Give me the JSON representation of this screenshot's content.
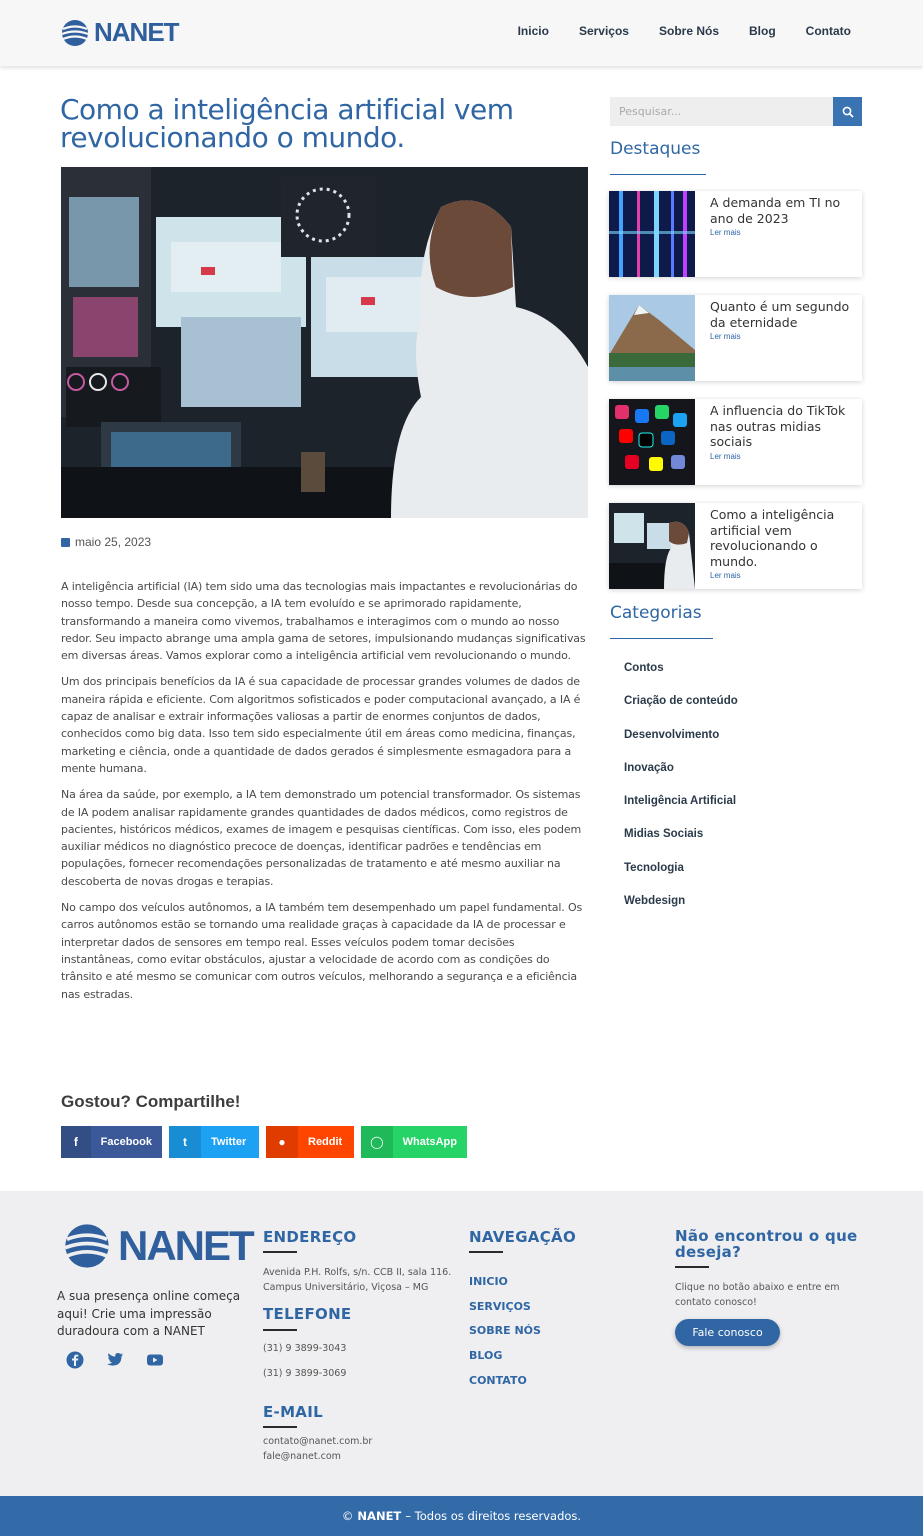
{
  "header": {
    "brand": "NANET",
    "nav": [
      "Inicio",
      "Serviços",
      "Sobre Nós",
      "Blog",
      "Contato"
    ]
  },
  "post": {
    "title": "Como a inteligência artificial vem revolucionando o mundo.",
    "date": "maio 25, 2023",
    "paragraphs": [
      "A inteligência artificial (IA) tem sido uma das tecnologias mais impactantes e revolucionárias do nosso tempo. Desde sua concepção, a IA tem evoluído e se aprimorado rapidamente, transformando a maneira como vivemos, trabalhamos e interagimos com o mundo ao nosso redor. Seu impacto abrange uma ampla gama de setores, impulsionando mudanças significativas em diversas áreas. Vamos explorar como a inteligência artificial vem revolucionando o mundo.",
      "Um dos principais benefícios da IA é sua capacidade de processar grandes volumes de dados de maneira rápida e eficiente. Com algoritmos sofisticados e poder computacional avançado, a IA é capaz de analisar e extrair informações valiosas a partir de enormes conjuntos de dados, conhecidos como big data. Isso tem sido especialmente útil em áreas como medicina, finanças, marketing e ciência, onde a quantidade de dados gerados é simplesmente esmagadora para a mente humana.",
      "Na área da saúde, por exemplo, a IA tem demonstrado um potencial transformador. Os sistemas de IA podem analisar rapidamente grandes quantidades de dados médicos, como registros de pacientes, históricos médicos, exames de imagem e pesquisas científicas. Com isso, eles podem auxiliar médicos no diagnóstico precoce de doenças, identificar padrões e tendências em populações, fornecer recomendações personalizadas de tratamento e até mesmo auxiliar na descoberta de novas drogas e terapias.",
      "No campo dos veículos autônomos, a IA também tem desempenhado um papel fundamental. Os carros autônomos estão se tornando uma realidade graças à capacidade da IA de processar e interpretar dados de sensores em tempo real. Esses veículos podem tomar decisões instantâneas, como evitar obstáculos, ajustar a velocidade de acordo com as condições do trânsito e até mesmo se comunicar com outros veículos, melhorando a segurança e a eficiência nas estradas."
    ]
  },
  "share": {
    "title": "Gostou? Compartilhe!",
    "buttons": [
      {
        "label": "Facebook",
        "color": "#3b5998",
        "icon": "facebook-icon"
      },
      {
        "label": "Twitter",
        "color": "#1da1f2",
        "icon": "twitter-icon"
      },
      {
        "label": "Reddit",
        "color": "#ff4500",
        "icon": "reddit-icon"
      },
      {
        "label": "WhatsApp",
        "color": "#25d366",
        "icon": "whatsapp-icon"
      }
    ]
  },
  "sidebar": {
    "search_placeholder": "Pesquisar...",
    "featured_title": "Destaques",
    "read_more": "Ler mais",
    "featured": [
      "A demanda em TI no ano de 2023",
      "Quanto é um segundo da eternidade",
      "A influencia do TikTok nas outras midias sociais",
      "Como a inteligência artificial vem revolucionando o mundo."
    ],
    "categories_title": "Categorias",
    "categories": [
      "Contos",
      "Criação de conteúdo",
      "Desenvolvimento",
      "Inovação",
      "Inteligência Artificial",
      "Midias Sociais",
      "Tecnologia",
      "Webdesign"
    ]
  },
  "footer": {
    "brand": "NANET",
    "tagline": "A sua presença online começa aqui! Crie uma impressão duradoura com a NANET",
    "address_title": "ENDEREÇO",
    "address": "Avenida P.H. Rolfs, s/n. CCB II, sala 116. Campus Universitário, Viçosa – MG",
    "phone_title": "TELEFONE",
    "phones": [
      "(31) 9 3899-3043",
      "(31) 9 3899-3069"
    ],
    "email_title": "E-MAIL",
    "emails": [
      "contato@nanet.com.br",
      "fale@nanet.com"
    ],
    "nav_title": "NAVEGAÇÃO",
    "nav": [
      "INICIO",
      "SERVIÇOS",
      "SOBRE NÓS",
      "BLOG",
      "CONTATO"
    ],
    "cta_title": "Não encontrou o que deseja?",
    "cta_text": "Clique no botão abaixo e entre em contato conosco!",
    "cta_button": "Fale conosco",
    "copyright_prefix": "©",
    "copyright_brand": "NANET",
    "copyright_text": "– Todos os direitos reservados."
  },
  "colors": {
    "brand": "#2f66a3",
    "footer_bar": "#336aa8"
  }
}
